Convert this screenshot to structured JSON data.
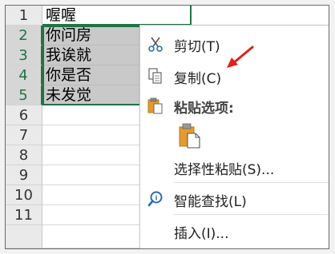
{
  "rows": [
    {
      "num": "1",
      "value": "喔喔"
    },
    {
      "num": "2",
      "value": "你问房"
    },
    {
      "num": "3",
      "value": "我诶就"
    },
    {
      "num": "4",
      "value": "你是否"
    },
    {
      "num": "5",
      "value": "未发觉"
    },
    {
      "num": "6",
      "value": ""
    },
    {
      "num": "7",
      "value": ""
    },
    {
      "num": "8",
      "value": ""
    },
    {
      "num": "9",
      "value": ""
    },
    {
      "num": "10",
      "value": ""
    },
    {
      "num": "11",
      "value": ""
    }
  ],
  "context_menu": {
    "cut": "剪切(T)",
    "copy": "复制(C)",
    "paste_options": "粘贴选项:",
    "paste_special": "选择性粘贴(S)...",
    "smart_lookup": "智能查找(L)",
    "insert": "插入(I)..."
  },
  "colors": {
    "selection_border": "#217346",
    "selected_fill": "#c9c9c9",
    "arrow": "#e0201c",
    "icon_blue": "#2b6cb0",
    "clipboard_orange": "#e39b2e"
  },
  "icons": {
    "cut": "scissors-icon",
    "copy": "copy-icon",
    "paste": "clipboard-icon",
    "paste_option": "clipboard-keep-source-icon",
    "smart_lookup": "search-icon",
    "annotation": "red-arrow-icon"
  }
}
